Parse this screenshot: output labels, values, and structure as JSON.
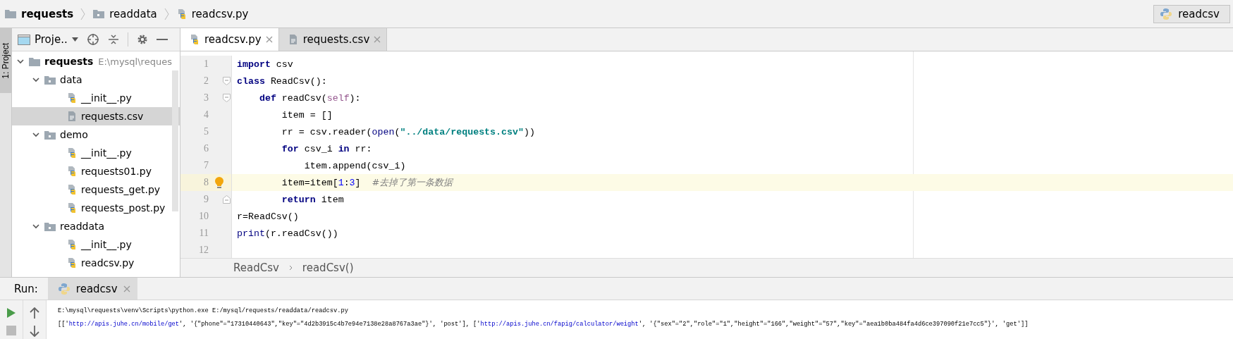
{
  "breadcrumb": [
    {
      "label": "requests",
      "kind": "root"
    },
    {
      "label": "readdata",
      "kind": "module"
    },
    {
      "label": "readcsv.py",
      "kind": "python"
    }
  ],
  "run_config": {
    "label": "readcsv"
  },
  "tool_stripe": {
    "label": "1: Project"
  },
  "project_panel": {
    "title": "Proje..",
    "tree": [
      {
        "label": "requests",
        "path": "E:\\mysql\\reques",
        "kind": "root",
        "expanded": true,
        "selected": false,
        "children": [
          {
            "label": "data",
            "kind": "folder",
            "expanded": true,
            "selected": false,
            "children": [
              {
                "label": "__init__.py",
                "kind": "python",
                "selected": false
              },
              {
                "label": "requests.csv",
                "kind": "csv",
                "selected": true
              }
            ]
          },
          {
            "label": "demo",
            "kind": "folder",
            "expanded": true,
            "selected": false,
            "children": [
              {
                "label": "__init__.py",
                "kind": "python",
                "selected": false
              },
              {
                "label": "requests01.py",
                "kind": "python",
                "selected": false
              },
              {
                "label": "requests_get.py",
                "kind": "python",
                "selected": false
              },
              {
                "label": "requests_post.py",
                "kind": "python",
                "selected": false
              }
            ]
          },
          {
            "label": "readdata",
            "kind": "folder",
            "expanded": true,
            "selected": false,
            "children": [
              {
                "label": "__init__.py",
                "kind": "python",
                "selected": false
              },
              {
                "label": "readcsv.py",
                "kind": "python",
                "selected": false
              }
            ]
          }
        ]
      }
    ]
  },
  "editor": {
    "tabs": [
      {
        "label": "readcsv.py",
        "kind": "python",
        "selected": true
      },
      {
        "label": "requests.csv",
        "kind": "csv",
        "selected": false
      }
    ],
    "lines": [
      {
        "number": "1",
        "current": false,
        "fold_open": false,
        "fold_close": false,
        "bulb": false,
        "segments": [
          {
            "kind": "keyword",
            "text": "import"
          },
          {
            "kind": "plain",
            "text": " csv"
          }
        ]
      },
      {
        "number": "2",
        "current": false,
        "fold_open": true,
        "fold_close": false,
        "bulb": false,
        "segments": [
          {
            "kind": "keyword",
            "text": "class"
          },
          {
            "kind": "plain",
            "text": " ReadCsv():"
          }
        ]
      },
      {
        "number": "3",
        "current": false,
        "fold_open": true,
        "fold_close": false,
        "bulb": false,
        "segments": [
          {
            "kind": "keyword",
            "text": "    def"
          },
          {
            "kind": "plain",
            "text": " readCsv("
          },
          {
            "kind": "self",
            "text": "self"
          },
          {
            "kind": "plain",
            "text": "):"
          }
        ]
      },
      {
        "number": "4",
        "current": false,
        "fold_open": false,
        "fold_close": false,
        "bulb": false,
        "segments": [
          {
            "kind": "plain",
            "text": "        item = []"
          }
        ]
      },
      {
        "number": "5",
        "current": false,
        "fold_open": false,
        "fold_close": false,
        "bulb": false,
        "segments": [
          {
            "kind": "plain",
            "text": "        rr = csv.reader("
          },
          {
            "kind": "builtin",
            "text": "open"
          },
          {
            "kind": "plain",
            "text": "("
          },
          {
            "kind": "string",
            "text": "\"../data/requests.csv\""
          },
          {
            "kind": "plain",
            "text": "))"
          }
        ]
      },
      {
        "number": "6",
        "current": false,
        "fold_open": false,
        "fold_close": false,
        "bulb": false,
        "segments": [
          {
            "kind": "keyword",
            "text": "        for"
          },
          {
            "kind": "plain",
            "text": " csv_i "
          },
          {
            "kind": "keyword",
            "text": "in"
          },
          {
            "kind": "plain",
            "text": " rr:"
          }
        ]
      },
      {
        "number": "7",
        "current": false,
        "fold_open": false,
        "fold_close": false,
        "bulb": false,
        "segments": [
          {
            "kind": "plain",
            "text": "            item.append(csv_i)"
          }
        ]
      },
      {
        "number": "8",
        "current": true,
        "fold_open": false,
        "fold_close": false,
        "bulb": true,
        "segments": [
          {
            "kind": "plain",
            "text": "        item=item["
          },
          {
            "kind": "number",
            "text": "1"
          },
          {
            "kind": "plain",
            "text": ":"
          },
          {
            "kind": "number",
            "text": "3"
          },
          {
            "kind": "plain",
            "text": "]  "
          },
          {
            "kind": "comment",
            "text": "#去掉了第一条数据"
          }
        ]
      },
      {
        "number": "9",
        "current": false,
        "fold_open": false,
        "fold_close": true,
        "bulb": false,
        "segments": [
          {
            "kind": "keyword",
            "text": "        return"
          },
          {
            "kind": "plain",
            "text": " item"
          }
        ]
      },
      {
        "number": "10",
        "current": false,
        "fold_open": false,
        "fold_close": false,
        "bulb": false,
        "segments": [
          {
            "kind": "plain",
            "text": "r=ReadCsv()"
          }
        ]
      },
      {
        "number": "11",
        "current": false,
        "fold_open": false,
        "fold_close": false,
        "bulb": false,
        "segments": [
          {
            "kind": "builtin",
            "text": "print"
          },
          {
            "kind": "plain",
            "text": "(r.readCsv())"
          }
        ]
      },
      {
        "number": "12",
        "current": false,
        "fold_open": false,
        "fold_close": false,
        "bulb": false
      }
    ],
    "breadcrumb": [
      "ReadCsv",
      "readCsv()"
    ]
  },
  "run": {
    "title": "Run:",
    "tab": "readcsv",
    "output": [
      {
        "segments": [
          {
            "kind": "plain",
            "text": "E:\\mysql\\requests\\venv\\Scripts\\python.exe E:/mysql/requests/readdata/readcsv.py"
          }
        ]
      },
      {
        "segments": [
          {
            "kind": "plain",
            "text": "[['"
          },
          {
            "kind": "link",
            "text": "http://apis.juhe.cn/mobile/get"
          },
          {
            "kind": "plain",
            "text": "', '{\"phone\"=\"17310440643\",\"key\"=\"4d2b3915c4b7e94e7138e28a8767a3ae\"}', 'post'], ['"
          },
          {
            "kind": "link",
            "text": "http://apis.juhe.cn/fapig/calculator/weight"
          },
          {
            "kind": "plain",
            "text": "', '{\"sex\"=\"2\",\"role\"=\"1\",\"height\"=\"166\",\"weight\"=\"57\",\"key\"=\"aea1b0ba484fa4d6ce397090f21e7cc5\"}', 'get']]"
          }
        ]
      }
    ]
  }
}
